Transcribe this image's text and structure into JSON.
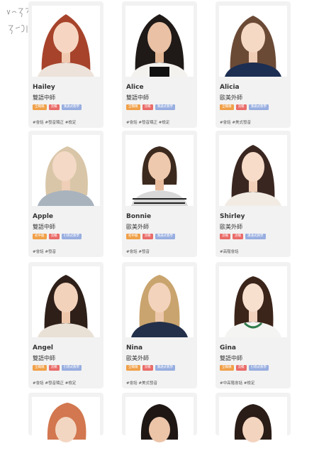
{
  "page": {
    "note_text": "vc 3/4\n3/2 9"
  },
  "teachers": [
    {
      "name": "Hailey",
      "role": "雙語中師",
      "tags": [
        "全職稱",
        "流暢",
        "溝通式教學"
      ],
      "hashtags": "#會話 #發音矯正 #檢定"
    },
    {
      "name": "Alice",
      "role": "雙語中師",
      "tags": [
        "全職稱",
        "流暢",
        "溝通式教學"
      ],
      "hashtags": "#會話 #發音矯正 #檢定"
    },
    {
      "name": "Alicia",
      "role": "歐美外師",
      "tags": [
        "全職稱",
        "流暢",
        "溝通式教學"
      ],
      "hashtags": "#會話 #美式發音"
    },
    {
      "name": "Apple",
      "role": "雙語中師",
      "tags": [
        "初中級",
        "流暢",
        "引導式教學"
      ],
      "hashtags": "#會話 #發音"
    },
    {
      "name": "Bonnie",
      "role": "歐美外師",
      "tags": [
        "初中級",
        "流暢",
        "溝通式教學"
      ],
      "hashtags": "#會話 #發音"
    },
    {
      "name": "Shirley",
      "role": "歐美外師",
      "tags": [
        "流暢",
        "流暢",
        "溝通式教學"
      ],
      "hashtags": "#高階會話"
    },
    {
      "name": "Angel",
      "role": "雙語中師",
      "tags": [
        "全職稱",
        "流暢",
        "引導式教學"
      ],
      "hashtags": "#會話 #發音矯正 #檢定"
    },
    {
      "name": "Nina",
      "role": "歐美外師",
      "tags": [
        "全職稱",
        "流暢",
        "溝通式教學"
      ],
      "hashtags": "#會話 #美式發音"
    },
    {
      "name": "Gina",
      "role": "雙語中師",
      "tags": [
        "全職稱",
        "流暢",
        "引導式教學"
      ],
      "hashtags": "#中高階會話 #檢定"
    }
  ],
  "colors": {
    "tag_level": "#f0a048",
    "tag_fluency": "#e96b68",
    "tag_method": "#98aee0",
    "card_bg": "#f2f2f2"
  }
}
